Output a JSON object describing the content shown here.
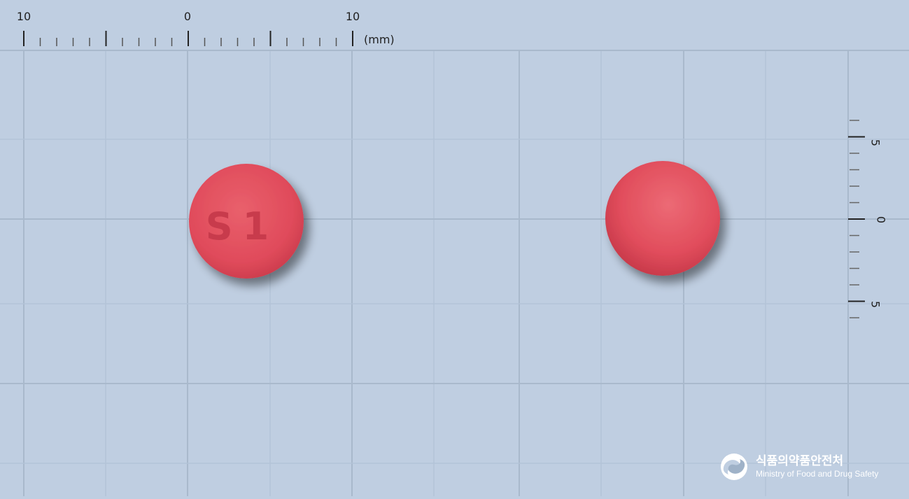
{
  "ruler_top": {
    "labels": [
      "10",
      "0",
      "10"
    ],
    "unit": "(mm)"
  },
  "ruler_right": {
    "labels": [
      "5",
      "0",
      "5"
    ]
  },
  "pill_front": {
    "imprint": "S1",
    "color": "#e2505f"
  },
  "pill_back": {
    "color": "#e2505f"
  },
  "logo": {
    "korean": "식품의약품안전처",
    "english": "Ministry of Food and Drug Safety",
    "icon": "mfds-emblem-icon"
  },
  "colors": {
    "background": "#bfcee1",
    "grid_major": "#a9b9cc",
    "grid_minor": "#b3c3d7",
    "pill": "#e2505f"
  }
}
